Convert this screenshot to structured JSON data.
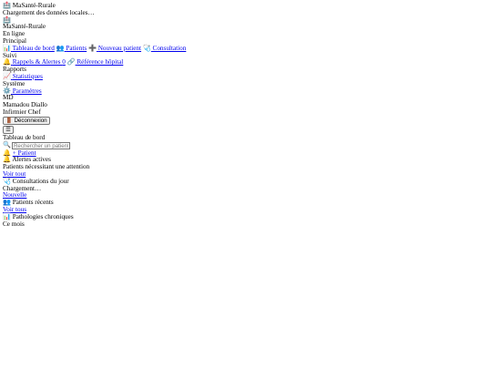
{
  "loader": {
    "brand_icon": "🏥",
    "brand": "MaSanté-Rurale",
    "message": "Chargement des données locales…"
  },
  "sidebar": {
    "logo_icon": "🏥",
    "brand": "MaSanté-Rurale",
    "status": "En ligne",
    "sections": {
      "principal": "Principal",
      "suivi": "Suivi",
      "rapports": "Rapports",
      "systeme": "Système"
    },
    "items": {
      "dashboard": {
        "icon": "📊",
        "label": "Tableau de bord"
      },
      "patients": {
        "icon": "👥",
        "label": "Patients"
      },
      "new_patient": {
        "icon": "➕",
        "label": "Nouveau patient"
      },
      "consultation": {
        "icon": "🩺",
        "label": "Consultation"
      },
      "reminders": {
        "icon": "🔔",
        "label": "Rappels & Alertes",
        "count": "0"
      },
      "referral": {
        "icon": "🔗",
        "label": "Référence hôpital"
      },
      "stats": {
        "icon": "📈",
        "label": "Statistiques"
      },
      "settings": {
        "icon": "⚙️",
        "label": "Paramètres"
      }
    },
    "user": {
      "initials": "MD",
      "name": "Mamadou Diallo",
      "role": "Infirmier Chef"
    },
    "logout": {
      "icon": "🚪",
      "label": "Déconnexion"
    }
  },
  "topbar": {
    "menu_glyph": "☰",
    "title": "Tableau de bord",
    "search_icon": "🔍",
    "search_placeholder": "Rechercher un patient...",
    "alert_icon": "🔔",
    "add_patient_label": "+ Patient"
  },
  "cards": {
    "alerts": {
      "icon": "🔔",
      "title": "Alertes actives",
      "subtitle": "Patients nécessitant une attention",
      "link": "Voir tout"
    },
    "consultations": {
      "icon": "🩺",
      "title": "Consultations du jour",
      "subtitle": "Chargement…",
      "link": "Nouvelle"
    },
    "recent": {
      "icon": "👥",
      "title": "Patients récents",
      "link": "Voir tous"
    },
    "chronic": {
      "icon": "📊",
      "title": "Pathologies chroniques",
      "subtitle": "Ce mois"
    }
  }
}
